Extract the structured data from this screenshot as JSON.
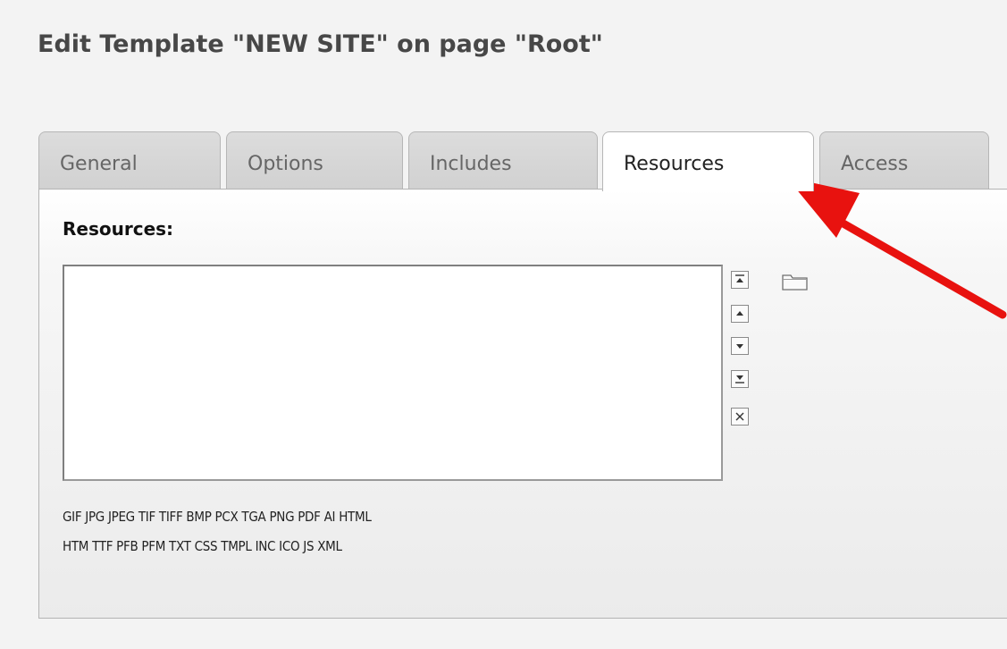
{
  "page": {
    "title": "Edit Template \"NEW SITE\" on page \"Root\""
  },
  "tabs": [
    {
      "label": "General"
    },
    {
      "label": "Options"
    },
    {
      "label": "Includes"
    },
    {
      "label": "Resources"
    },
    {
      "label": "Access"
    }
  ],
  "active_tab": "Resources",
  "resources": {
    "label": "Resources:",
    "items": [],
    "allowed_extensions_line1": "GIF JPG JPEG TIF TIFF BMP PCX TGA PNG PDF AI HTML",
    "allowed_extensions_line2": "HTM TTF PFB PFM TXT CSS TMPL INC ICO JS XML"
  },
  "controls": [
    {
      "icon": "move-to-top-icon"
    },
    {
      "icon": "move-up-icon"
    },
    {
      "icon": "move-down-icon"
    },
    {
      "icon": "move-to-bottom-icon"
    },
    {
      "icon": "remove-icon"
    },
    {
      "icon": "folder-icon"
    }
  ],
  "colors": {
    "annotation_arrow": "#e8120f",
    "title_text": "#474747",
    "tab_inactive_bg": "#d6d6d6",
    "tab_active_bg": "#ffffff"
  }
}
